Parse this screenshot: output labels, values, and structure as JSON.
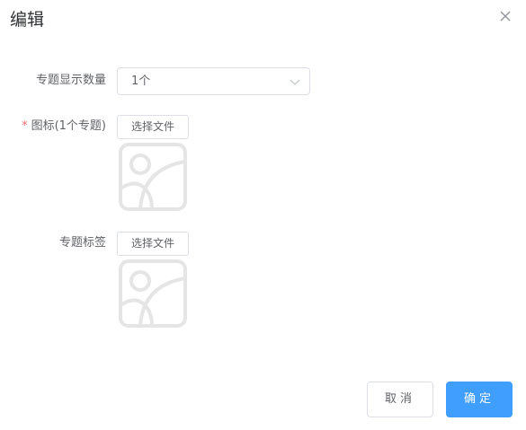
{
  "dialog": {
    "title": "编辑"
  },
  "form": {
    "topic_count": {
      "label": "专题显示数量",
      "selected": "1个"
    },
    "icon": {
      "required_mark": "*",
      "label": "图标(1个专题)",
      "button_label": "选择文件"
    },
    "tag": {
      "label": "专题标签",
      "button_label": "选择文件"
    }
  },
  "footer": {
    "cancel_label": "取消",
    "confirm_label": "确定"
  },
  "colors": {
    "primary": "#409eff",
    "required": "#f56c6c",
    "border": "#dcdfe6",
    "placeholder": "#e5e5e5"
  }
}
